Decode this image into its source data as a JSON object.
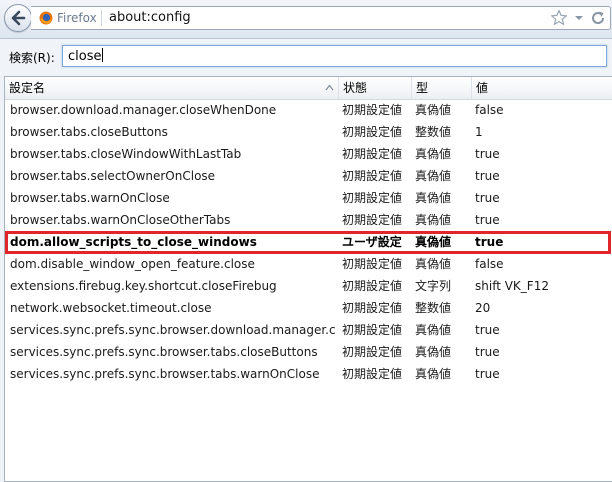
{
  "navbar": {
    "identity_label": "Firefox",
    "url": "about:config",
    "icons": [
      "back-arrow-icon",
      "firefox-logo-icon",
      "bookmark-star-icon",
      "history-dropdown-icon",
      "reload-icon"
    ]
  },
  "search": {
    "label": "検索(R):",
    "value": "close"
  },
  "table": {
    "headers": [
      "設定名",
      "状態",
      "型",
      "値"
    ],
    "rows": [
      {
        "name": "browser.download.manager.closeWhenDone",
        "status": "初期設定値",
        "type": "真偽値",
        "value": "false",
        "modified": false
      },
      {
        "name": "browser.tabs.closeButtons",
        "status": "初期設定値",
        "type": "整数値",
        "value": "1",
        "modified": false
      },
      {
        "name": "browser.tabs.closeWindowWithLastTab",
        "status": "初期設定値",
        "type": "真偽値",
        "value": "true",
        "modified": false
      },
      {
        "name": "browser.tabs.selectOwnerOnClose",
        "status": "初期設定値",
        "type": "真偽値",
        "value": "true",
        "modified": false
      },
      {
        "name": "browser.tabs.warnOnClose",
        "status": "初期設定値",
        "type": "真偽値",
        "value": "true",
        "modified": false
      },
      {
        "name": "browser.tabs.warnOnCloseOtherTabs",
        "status": "初期設定値",
        "type": "真偽値",
        "value": "true",
        "modified": false
      },
      {
        "name": "dom.allow_scripts_to_close_windows",
        "status": "ユーザ設定",
        "type": "真偽値",
        "value": "true",
        "modified": true
      },
      {
        "name": "dom.disable_window_open_feature.close",
        "status": "初期設定値",
        "type": "真偽値",
        "value": "false",
        "modified": false
      },
      {
        "name": "extensions.firebug.key.shortcut.closeFirebug",
        "status": "初期設定値",
        "type": "文字列",
        "value": "shift VK_F12",
        "modified": false
      },
      {
        "name": "network.websocket.timeout.close",
        "status": "初期設定値",
        "type": "整数値",
        "value": "20",
        "modified": false
      },
      {
        "name": "services.sync.prefs.sync.browser.download.manager.c...",
        "status": "初期設定値",
        "type": "真偽値",
        "value": "true",
        "modified": false
      },
      {
        "name": "services.sync.prefs.sync.browser.tabs.closeButtons",
        "status": "初期設定値",
        "type": "真偽値",
        "value": "true",
        "modified": false
      },
      {
        "name": "services.sync.prefs.sync.browser.tabs.warnOnClose",
        "status": "初期設定値",
        "type": "真偽値",
        "value": "true",
        "modified": false
      }
    ]
  },
  "colors": {
    "highlight": "#e0262b",
    "firefox_orange": "#e8740f"
  }
}
